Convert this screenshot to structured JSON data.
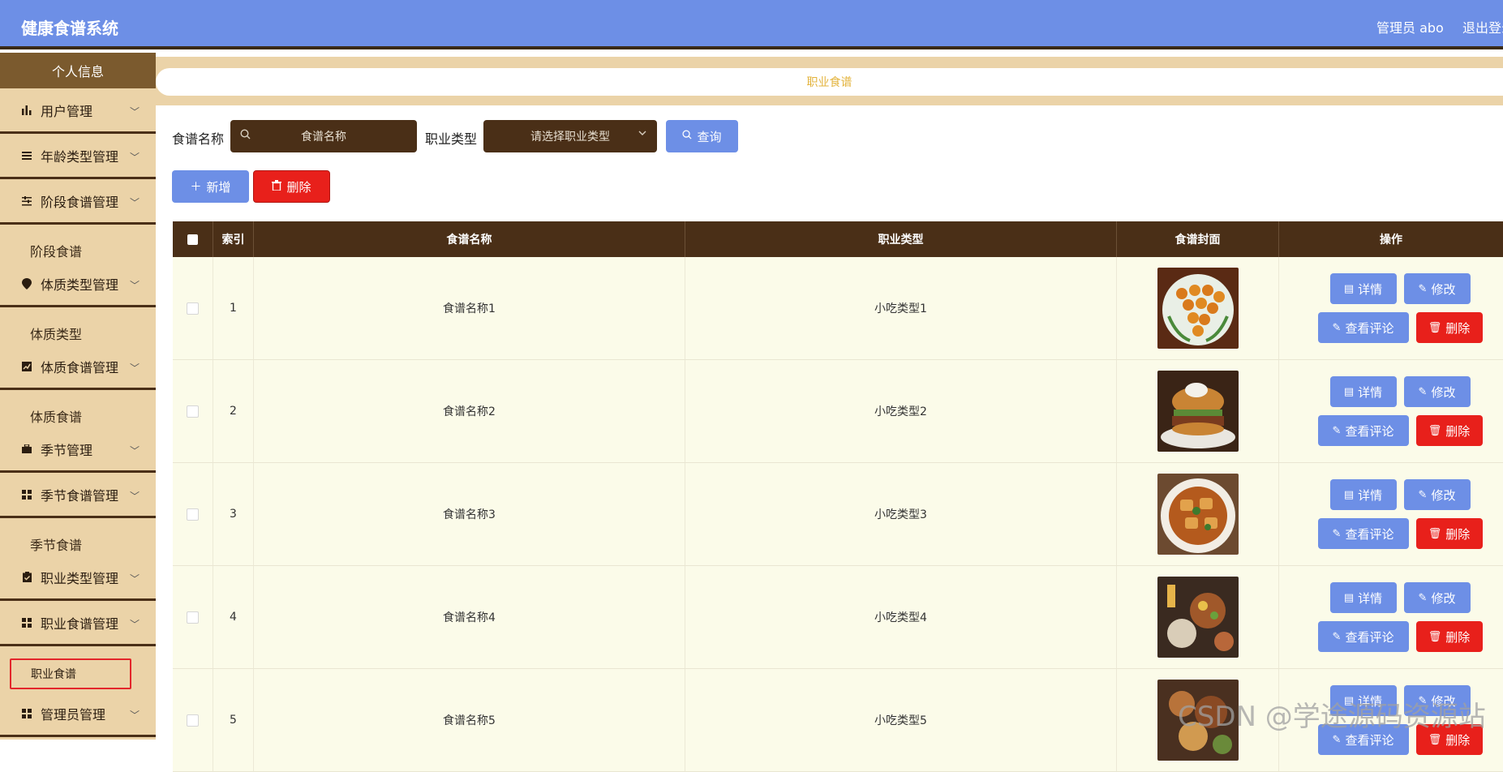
{
  "app": {
    "title": "健康食谱系统",
    "user_label": "管理员 abo",
    "logout_label": "退出登录"
  },
  "sidebar": {
    "top": "个人信息",
    "items": [
      {
        "label": "用户管理",
        "icon": "bar-chart-icon"
      },
      {
        "label": "年龄类型管理",
        "icon": "list-icon"
      },
      {
        "label": "阶段食谱管理",
        "icon": "sliders-icon"
      },
      {
        "label": "体质类型管理",
        "icon": "location-icon"
      },
      {
        "label": "体质食谱管理",
        "icon": "trend-icon"
      },
      {
        "label": "季节管理",
        "icon": "briefcase-icon"
      },
      {
        "label": "季节食谱管理",
        "icon": "grid-icon"
      },
      {
        "label": "职业类型管理",
        "icon": "clipboard-icon"
      },
      {
        "label": "职业食谱管理",
        "icon": "grid-icon"
      },
      {
        "label": "管理员管理",
        "icon": "grid-icon"
      }
    ],
    "subs": {
      "stage": "阶段食谱",
      "constitution_type": "体质类型",
      "constitution": "体质食谱",
      "season": "季节食谱",
      "career": "职业食谱"
    }
  },
  "breadcrumb": "职业食谱",
  "filters": {
    "name_label": "食谱名称",
    "name_placeholder": "食谱名称",
    "type_label": "职业类型",
    "type_placeholder": "请选择职业类型",
    "query_label": "查询"
  },
  "toolbar": {
    "add_label": "新增",
    "delete_label": "删除"
  },
  "table": {
    "headers": [
      "索引",
      "食谱名称",
      "职业类型",
      "食谱封面",
      "操作"
    ],
    "rows": [
      {
        "index": "1",
        "name": "食谱名称1",
        "type": "小吃类型1"
      },
      {
        "index": "2",
        "name": "食谱名称2",
        "type": "小吃类型2"
      },
      {
        "index": "3",
        "name": "食谱名称3",
        "type": "小吃类型3"
      },
      {
        "index": "4",
        "name": "食谱名称4",
        "type": "小吃类型4"
      },
      {
        "index": "5",
        "name": "食谱名称5",
        "type": "小吃类型5"
      }
    ],
    "actions": {
      "detail": "详情",
      "edit": "修改",
      "comments": "查看评论",
      "delete": "删除"
    }
  },
  "watermark": "CSDN @学途源码资源站",
  "colors": {
    "header": "#6d8fe6",
    "sidebar": "#ebd3a8",
    "dark_brown": "#4a2f17",
    "danger": "#e8201b",
    "accent": "#e3b33c"
  }
}
